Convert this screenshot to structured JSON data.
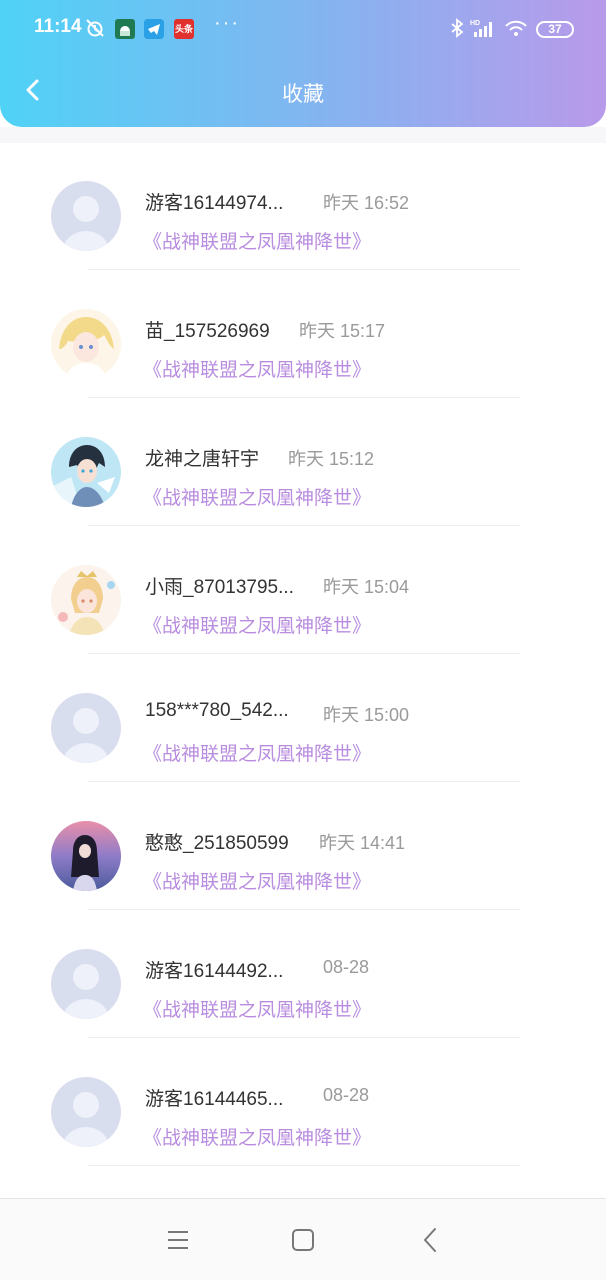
{
  "status_bar": {
    "time": "11:14",
    "app_badge_toutiao": "头条",
    "more_dots": "···",
    "battery": "37",
    "network": "HD"
  },
  "header": {
    "title": "收藏",
    "back_icon": "chevron-left-icon",
    "gradient_start": "#4fd2f6",
    "gradient_end": "#b99aea"
  },
  "favorites": [
    {
      "user": "游客16144974...",
      "time": "昨天 16:52",
      "book": "《战神联盟之凤凰神降世》",
      "avatar": "default"
    },
    {
      "user": "苗_157526969",
      "time": "昨天 15:17",
      "book": "《战神联盟之凤凰神降世》",
      "avatar": "anime-blonde"
    },
    {
      "user": "龙神之唐轩宇",
      "time": "昨天 15:12",
      "book": "《战神联盟之凤凰神降世》",
      "avatar": "anime-boy"
    },
    {
      "user": "小雨_87013795...",
      "time": "昨天 15:04",
      "book": "《战神联盟之凤凰神降世》",
      "avatar": "anime-girl"
    },
    {
      "user": "158***780_542...",
      "time": "昨天 15:00",
      "book": "《战神联盟之凤凰神降世》",
      "avatar": "default"
    },
    {
      "user": "憨憨_251850599",
      "time": "昨天 14:41",
      "book": "《战神联盟之凤凰神降世》",
      "avatar": "anime-night"
    },
    {
      "user": "游客16144492...",
      "time": "08-28",
      "book": "《战神联盟之凤凰神降世》",
      "avatar": "default"
    },
    {
      "user": "游客16144465...",
      "time": "08-28",
      "book": "《战神联盟之凤凰神降世》",
      "avatar": "default"
    }
  ],
  "colors": {
    "book_title": "#b88cdf",
    "username": "#333333",
    "timestamp": "#9a9a9a",
    "default_avatar_bg": "#d9deef"
  },
  "nav": {
    "menu_icon": "menu-icon",
    "home_icon": "home-square-icon",
    "back_icon": "back-triangle-icon"
  }
}
